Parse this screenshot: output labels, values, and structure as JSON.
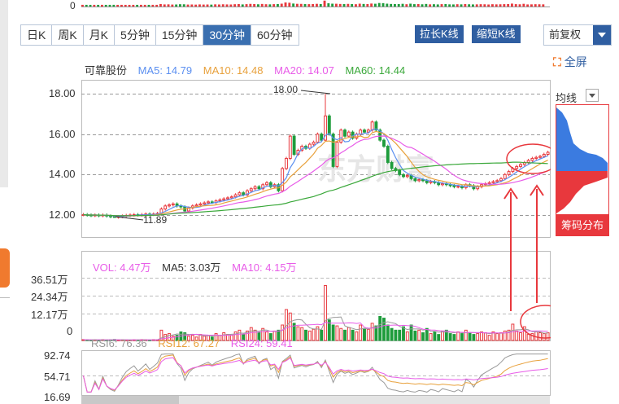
{
  "top_axis": {
    "label": "0"
  },
  "period_tabs": [
    {
      "label": "日K",
      "active": false
    },
    {
      "label": "周K",
      "active": false
    },
    {
      "label": "月K",
      "active": false
    },
    {
      "label": "5分钟",
      "active": false
    },
    {
      "label": "15分钟",
      "active": false
    },
    {
      "label": "30分钟",
      "active": true
    },
    {
      "label": "60分钟",
      "active": false
    }
  ],
  "toolbar": {
    "stretch_label": "拉长K线",
    "shrink_label": "缩短K线",
    "adjust_label": "前复权",
    "fullscreen_label": "全屏"
  },
  "price_legend": {
    "name": "可靠股份",
    "ma5": "MA5: 14.79",
    "ma10": "MA10: 14.48",
    "ma20": "MA20: 14.07",
    "ma60": "MA60: 14.44"
  },
  "price_axis": {
    "ticks": [
      "18.00",
      "16.00",
      "14.00",
      "12.00"
    ]
  },
  "annotations": {
    "high": "18.00",
    "low": "11.89"
  },
  "watermark": "东方财富",
  "right_panel": {
    "junxian_label": "均线",
    "chip_label": "筹码分布"
  },
  "volume_legend": {
    "vol": "VOL: 4.47万",
    "ma5": "MA5: 3.03万",
    "ma10": "MA10: 4.15万"
  },
  "volume_axis": {
    "ticks": [
      "36.51万",
      "24.34万",
      "12.17万",
      "0"
    ]
  },
  "rsi_legend": {
    "rsi6": "RSI6: 76.36",
    "rsi12": "RSI12: 67.27",
    "rsi24": "RSI24: 59.41"
  },
  "rsi_axis": {
    "ticks": [
      "92.74",
      "54.71",
      "16.69"
    ]
  },
  "colors": {
    "up": "#e8383d",
    "down": "#1e9c3c",
    "ma5": "#5b8ff0",
    "ma10": "#e8a13c",
    "ma20": "#e85ce8",
    "ma60": "#3aa83a",
    "accent": "#2f5ea1"
  },
  "chart_data": {
    "type": "candlestick",
    "price_ylim": [
      11.5,
      18.5
    ],
    "closes": [
      12.02,
      12.0,
      11.98,
      12.0,
      11.97,
      12.0,
      11.95,
      11.92,
      11.9,
      11.92,
      11.95,
      11.98,
      12.0,
      12.02,
      12.0,
      12.02,
      12.05,
      12.03,
      12.05,
      12.08,
      12.3,
      12.45,
      12.5,
      12.55,
      12.45,
      12.4,
      12.2,
      12.35,
      12.45,
      12.5,
      12.55,
      12.6,
      12.65,
      12.62,
      12.7,
      12.75,
      12.8,
      12.85,
      12.9,
      13.0,
      13.1,
      13.0,
      13.2,
      13.3,
      13.4,
      13.3,
      13.5,
      13.6,
      13.4,
      13.5,
      13.2,
      14.3,
      14.8,
      15.9,
      15.0,
      15.2,
      15.4,
      15.3,
      15.5,
      15.6,
      16.0,
      15.7,
      16.9,
      16.0,
      14.4,
      15.6,
      16.2,
      15.9,
      16.1,
      15.8,
      16.0,
      16.2,
      16.1,
      16.2,
      16.6,
      16.2,
      15.7,
      15.4,
      14.6,
      14.3,
      14.2,
      14.0,
      13.9,
      13.95,
      13.8,
      13.7,
      13.75,
      13.7,
      13.6,
      13.65,
      13.6,
      13.5,
      13.55,
      13.5,
      13.45,
      13.4,
      13.42,
      13.35,
      13.5,
      13.45,
      13.3,
      13.4,
      13.5,
      13.55,
      13.6,
      13.65,
      13.7,
      13.8,
      14.0,
      14.15,
      14.3,
      14.4,
      14.5,
      14.6,
      14.7,
      14.8,
      14.85,
      14.9,
      15.0,
      15.1
    ],
    "high_point": {
      "value": 18.0
    },
    "low_point": {
      "value": 11.89
    },
    "volume_ylim": [
      0,
      36.51
    ],
    "volume_unit": "万",
    "volumes": [
      0.5,
      0.4,
      0.3,
      0.4,
      0.3,
      0.5,
      0.3,
      0.4,
      0.6,
      0.3,
      0.4,
      0.3,
      0.2,
      0.4,
      0.3,
      0.5,
      0.4,
      0.3,
      0.5,
      0.4,
      6.0,
      3.5,
      4.0,
      2.5,
      3.0,
      5.0,
      4.5,
      2.5,
      3.0,
      2.0,
      3.5,
      2.5,
      3.0,
      2.0,
      4.0,
      3.0,
      4.5,
      3.5,
      3.0,
      5.0,
      6.0,
      3.5,
      5.5,
      7.5,
      6.0,
      4.5,
      7.0,
      5.0,
      4.0,
      5.5,
      6.0,
      9.0,
      18.0,
      16.0,
      10.0,
      8.0,
      7.5,
      6.0,
      5.5,
      6.5,
      8.0,
      6.0,
      32.0,
      12.0,
      9.0,
      8.5,
      7.0,
      6.0,
      7.5,
      6.0,
      5.0,
      9.0,
      7.0,
      6.5,
      10.0,
      8.5,
      14.0,
      13.0,
      9.0,
      7.0,
      6.0,
      6.0,
      8.0,
      5.0,
      9.0,
      5.5,
      6.0,
      4.5,
      7.0,
      4.0,
      5.0,
      3.5,
      5.5,
      6.0,
      4.0,
      3.5,
      5.0,
      4.0,
      6.0,
      4.5,
      3.5,
      4.0,
      5.0,
      4.5,
      3.0,
      5.0,
      4.0,
      4.5,
      5.5,
      6.0,
      9.5,
      5.5,
      4.5,
      8.0,
      3.5,
      4.0,
      5.0,
      4.5,
      4.0,
      4.47
    ],
    "rsi_ylim": [
      16.69,
      92.74
    ]
  }
}
